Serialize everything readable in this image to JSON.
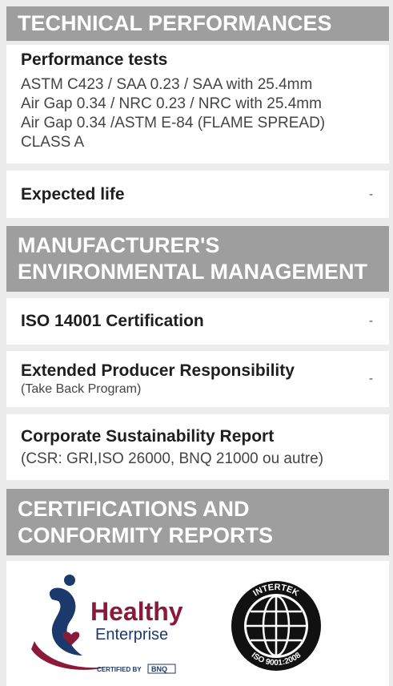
{
  "sections": {
    "technical": {
      "heading": "TECHNICAL PERFORMANCES"
    },
    "environmental": {
      "heading_line1": "MANUFACTURER'S",
      "heading_line2": "ENVIRONMENTAL MANAGEMENT"
    },
    "certifications": {
      "heading_line1": "CERTIFICATIONS AND",
      "heading_line2": "CONFORMITY REPORTS"
    }
  },
  "performance_tests": {
    "title": "Performance tests",
    "lines": [
      "ASTM C423 / SAA 0.23  / SAA with 25.4mm",
      "Air Gap 0.34 / NRC 0.23 /  NRC with 25.4mm",
      "Air Gap 0.34 /ASTM E-84 (FLAME SPREAD)",
      "CLASS A"
    ]
  },
  "expected_life": {
    "title": "Expected life",
    "value": "-"
  },
  "iso_14001": {
    "title": "ISO 14001 Certification",
    "value": "-"
  },
  "epr": {
    "title": "Extended Producer Responsibility",
    "subtitle": "(Take Back Program)",
    "value": "-"
  },
  "csr": {
    "title": "Corporate Sustainability Report",
    "subtitle": "(CSR: GRI,ISO 26000, BNQ 21000 ou autre)"
  },
  "logos": {
    "healthy": {
      "word1": "Healthy",
      "word2": "Enterprise",
      "certified": "CERTIFIED BY",
      "bnq": "BNQ"
    },
    "iso": {
      "top": "INTERTEK",
      "bottom": "ISO 9001:2008"
    },
    "colors": {
      "maroon": "#8b1a3a",
      "navy": "#1b3a6b",
      "black": "#111111"
    }
  }
}
